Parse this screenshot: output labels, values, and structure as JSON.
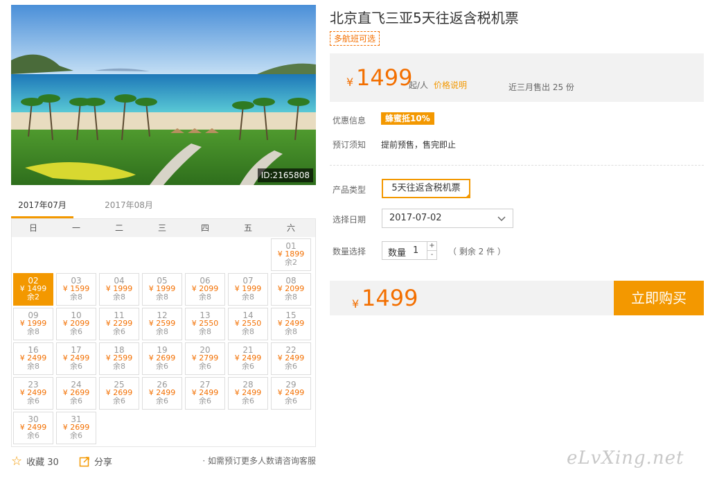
{
  "product": {
    "title": "北京直飞三亚5天往返含税机票",
    "tag": "多航班可选",
    "image_id": "ID:2165808"
  },
  "price_box": {
    "currency": "¥",
    "price": "1499",
    "unit": "起/人",
    "price_note_link": "价格说明",
    "sold": "近三月售出 25 份"
  },
  "info": {
    "promo_label": "优惠信息",
    "promo_badge": "蜂蜜抵10%",
    "booking_label": "预订须知",
    "booking_text": "提前预售，售完即止"
  },
  "options": {
    "type_label": "产品类型",
    "type_value": "5天往返含税机票",
    "date_label": "选择日期",
    "date_value": "2017-07-02",
    "qty_label": "数量选择",
    "qty_inner_label": "数量",
    "qty_value": "1",
    "qty_plus": "+",
    "qty_minus": "-",
    "remain": "（ 剩余 2 件 ）"
  },
  "total": {
    "currency": "¥",
    "price": "1499",
    "buy_button": "立即购买"
  },
  "calendar": {
    "tabs": [
      "2017年07月",
      "2017年08月"
    ],
    "weekdays": [
      "日",
      "一",
      "二",
      "三",
      "四",
      "五",
      "六"
    ],
    "days": [
      {
        "d": "01",
        "p": "¥ 1899",
        "s": "余2"
      },
      {
        "d": "02",
        "p": "¥ 1499",
        "s": "余2",
        "selected": true
      },
      {
        "d": "03",
        "p": "¥ 1599",
        "s": "余8"
      },
      {
        "d": "04",
        "p": "¥ 1999",
        "s": "余8"
      },
      {
        "d": "05",
        "p": "¥ 1999",
        "s": "余8"
      },
      {
        "d": "06",
        "p": "¥ 2099",
        "s": "余8"
      },
      {
        "d": "07",
        "p": "¥ 1999",
        "s": "余8"
      },
      {
        "d": "08",
        "p": "¥ 2099",
        "s": "余8"
      },
      {
        "d": "09",
        "p": "¥ 1999",
        "s": "余8"
      },
      {
        "d": "10",
        "p": "¥ 2099",
        "s": "余6"
      },
      {
        "d": "11",
        "p": "¥ 2299",
        "s": "余6"
      },
      {
        "d": "12",
        "p": "¥ 2599",
        "s": "余8"
      },
      {
        "d": "13",
        "p": "¥ 2550",
        "s": "余8"
      },
      {
        "d": "14",
        "p": "¥ 2550",
        "s": "余8"
      },
      {
        "d": "15",
        "p": "¥ 2499",
        "s": "余8"
      },
      {
        "d": "16",
        "p": "¥ 2499",
        "s": "余8"
      },
      {
        "d": "17",
        "p": "¥ 2499",
        "s": "余6"
      },
      {
        "d": "18",
        "p": "¥ 2599",
        "s": "余8"
      },
      {
        "d": "19",
        "p": "¥ 2699",
        "s": "余6"
      },
      {
        "d": "20",
        "p": "¥ 2799",
        "s": "余6"
      },
      {
        "d": "21",
        "p": "¥ 2499",
        "s": "余6"
      },
      {
        "d": "22",
        "p": "¥ 2499",
        "s": "余6"
      },
      {
        "d": "23",
        "p": "¥ 2499",
        "s": "余6"
      },
      {
        "d": "24",
        "p": "¥ 2699",
        "s": "余6"
      },
      {
        "d": "25",
        "p": "¥ 2699",
        "s": "余6"
      },
      {
        "d": "26",
        "p": "¥ 2499",
        "s": "余6"
      },
      {
        "d": "27",
        "p": "¥ 2499",
        "s": "余6"
      },
      {
        "d": "28",
        "p": "¥ 2499",
        "s": "余6"
      },
      {
        "d": "29",
        "p": "¥ 2499",
        "s": "余6"
      },
      {
        "d": "30",
        "p": "¥ 2499",
        "s": "余6"
      },
      {
        "d": "31",
        "p": "¥ 2699",
        "s": "余6"
      }
    ]
  },
  "actions": {
    "favorite": "收藏 30",
    "share": "分享",
    "note": "· 如需预订更多人数请咨询客服"
  },
  "watermark": "eLvXing.net",
  "colors": {
    "accent": "#f39800",
    "price": "#f36f00"
  }
}
